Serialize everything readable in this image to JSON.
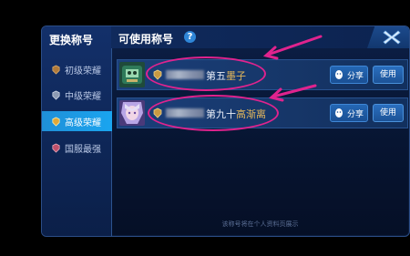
{
  "sidebar": {
    "title": "更换称号",
    "items": [
      {
        "label": "初级荣耀"
      },
      {
        "label": "中级荣耀"
      },
      {
        "label": "高级荣耀"
      },
      {
        "label": "国服最强"
      }
    ],
    "active_index": 2
  },
  "header": {
    "title": "可使用称号",
    "help_glyph": "?"
  },
  "rows": [
    {
      "title_prefix": "第五",
      "title_suffix": "墨子",
      "share_label": "分享",
      "use_label": "使用"
    },
    {
      "title_prefix": "第九十",
      "title_suffix": "高渐离",
      "share_label": "分享",
      "use_label": "使用"
    }
  ],
  "footer": {
    "note": "该称号将在个人资料页展示"
  },
  "colors": {
    "accent_blue": "#1aa5f0",
    "annotation_magenta": "#e0238e",
    "gold": "#e4b75a"
  }
}
